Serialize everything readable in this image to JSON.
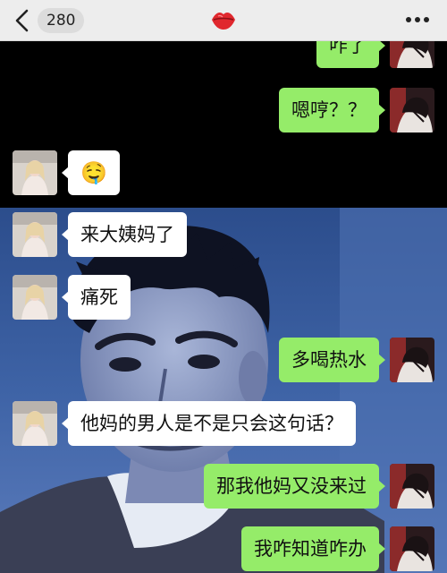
{
  "header": {
    "unread_count": "280",
    "back_icon": "chevron-left-icon",
    "title_icon": "lips-icon",
    "more_icon": "more-dots-icon"
  },
  "messages": [
    {
      "side": "out",
      "text": "咋了"
    },
    {
      "side": "out",
      "text": "嗯哼？？"
    },
    {
      "side": "in",
      "text": "🤤"
    },
    {
      "side": "in",
      "text": "来大姨妈了"
    },
    {
      "side": "in",
      "text": "痛死"
    },
    {
      "side": "out",
      "text": "多喝热水"
    },
    {
      "side": "in",
      "text": "他妈的男人是不是只会这句话？"
    },
    {
      "side": "out",
      "text": "那我他妈又没来过"
    },
    {
      "side": "out",
      "text": "我咋知道咋办"
    }
  ],
  "colors": {
    "header_bg": "#ededed",
    "outgoing_bubble": "#95ec69",
    "incoming_bubble": "#ffffff",
    "chat_bg": "#000000",
    "title_icon": "#e0282e"
  }
}
